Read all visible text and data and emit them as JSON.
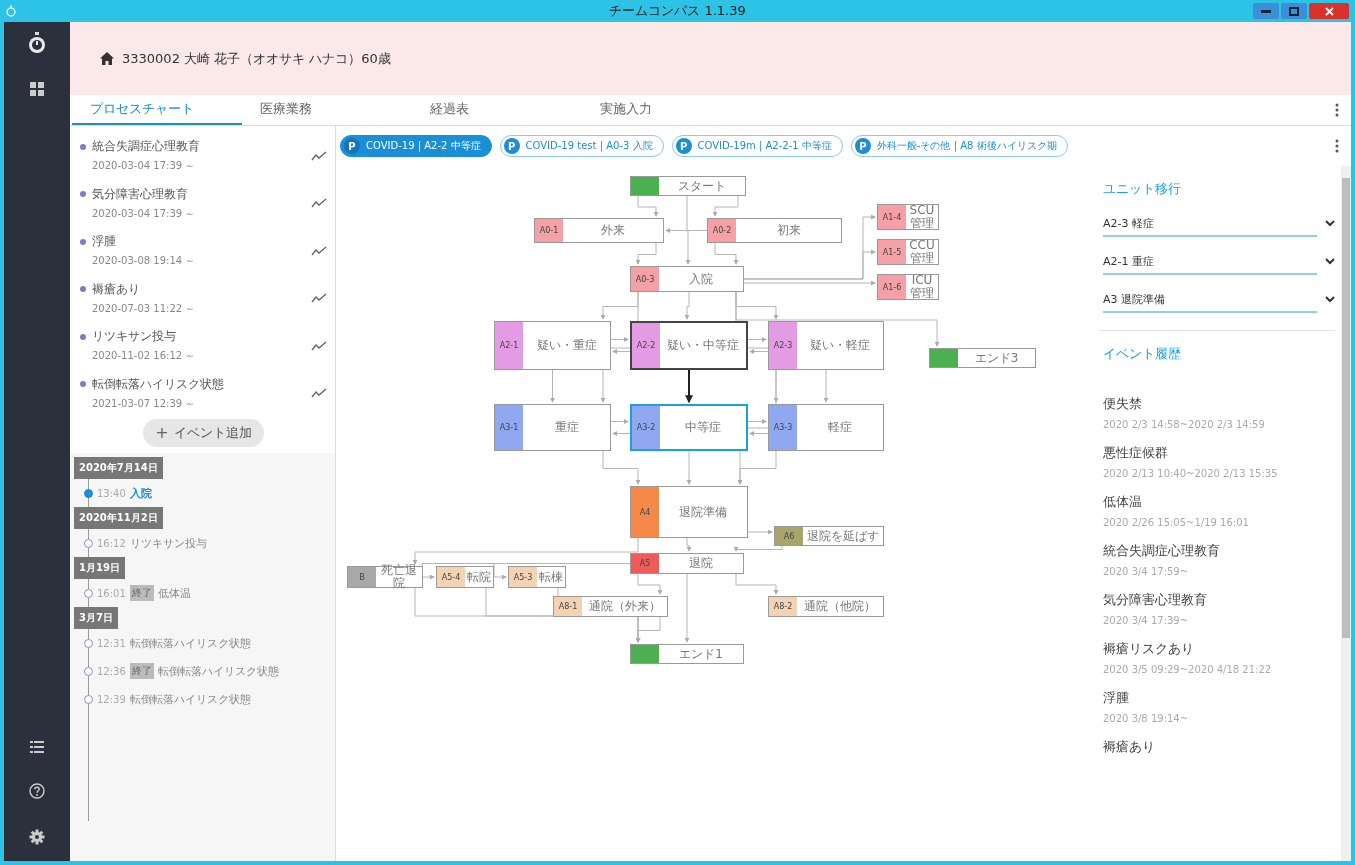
{
  "window": {
    "title": "チームコンパス 1.1.39"
  },
  "patient": {
    "label": "3330002 大崎 花子（オオサキ ハナコ）60歳"
  },
  "tabs": [
    {
      "label": "プロセスチャート",
      "selected": true
    },
    {
      "label": "医療業務",
      "selected": false
    },
    {
      "label": "経過表",
      "selected": false
    },
    {
      "label": "実施入力",
      "selected": false
    }
  ],
  "events": [
    {
      "title": "統合失調症心理教育",
      "date": "2020-03-04 17:39 ～"
    },
    {
      "title": "気分障害心理教育",
      "date": "2020-03-04 17:39 ～"
    },
    {
      "title": "浮腫",
      "date": "2020-03-08 19:14 ～"
    },
    {
      "title": "褥瘡あり",
      "date": "2020-07-03 11:22 ～"
    },
    {
      "title": "リツキサン投与",
      "date": "2020-11-02 16:12 ～"
    },
    {
      "title": "転倒転落ハイリスク状態",
      "date": "2021-03-07 12:39 ～"
    }
  ],
  "add_event_button": {
    "icon": "+",
    "label": "イベント追加"
  },
  "timeline": [
    {
      "date": "2020年7月14日",
      "entries": [
        {
          "time": "13:40",
          "text": "入院",
          "selected": true
        }
      ]
    },
    {
      "date": "2020年11月2日",
      "entries": [
        {
          "time": "16:12",
          "text": "リツキサン投与",
          "selected": false
        }
      ]
    },
    {
      "date": "1月19日",
      "entries": [
        {
          "time": "16:01",
          "tag": "終了",
          "text": "低体温",
          "selected": false
        }
      ]
    },
    {
      "date": "3月7日",
      "entries": [
        {
          "time": "12:31",
          "text": "転倒転落ハイリスク状態",
          "selected": false
        },
        {
          "time": "12:36",
          "tag": "終了",
          "text": "転倒転落ハイリスク状態",
          "selected": false
        },
        {
          "time": "12:39",
          "text": "転倒転落ハイリスク状態",
          "selected": false
        }
      ]
    }
  ],
  "pathways": [
    {
      "badge": "P",
      "label": "COVID-19 | A2-2 中等症",
      "selected": true
    },
    {
      "badge": "P",
      "label": "COVID-19 test | A0-3 入院",
      "selected": false
    },
    {
      "badge": "P",
      "label": "COVID-19m | A2-2-1 中等症",
      "selected": false
    },
    {
      "badge": "P",
      "label": "外科一般-その他 | A8 術後ハイリスク期",
      "selected": false
    }
  ],
  "chart_nodes": [
    {
      "name": "スタート",
      "color": "#4caf50",
      "selected": false,
      "visited": false
    },
    {
      "code": "A0-1",
      "name": "外来",
      "color": "#f4a0a6",
      "selected": false,
      "visited": false
    },
    {
      "code": "A0-2",
      "name": "初来",
      "color": "#f4a0a6",
      "selected": false,
      "visited": false
    },
    {
      "code": "A0-3",
      "name": "入院",
      "color": "#f4a0a6",
      "selected": false,
      "visited": false
    },
    {
      "code": "A1-4",
      "name": "SCU 管理",
      "color": "#f4a0a6",
      "selected": false,
      "visited": false
    },
    {
      "code": "A1-5",
      "name": "CCU 管理",
      "color": "#f4a0a6",
      "selected": false,
      "visited": false
    },
    {
      "code": "A1-6",
      "name": "ICU 管理",
      "color": "#f4a0a6",
      "selected": false,
      "visited": false
    },
    {
      "code": "A2-1",
      "name": "疑い・重症",
      "color": "#e39be3",
      "selected": false,
      "visited": false
    },
    {
      "code": "A2-2",
      "name": "疑い・中等症",
      "color": "#e39be3",
      "selected": false,
      "visited": true
    },
    {
      "code": "A2-3",
      "name": "疑い・軽症",
      "color": "#e39be3",
      "selected": false,
      "visited": false
    },
    {
      "name": "エンド3",
      "color": "#4caf50",
      "selected": false,
      "visited": false
    },
    {
      "code": "A3-1",
      "name": "重症",
      "color": "#8fa8f0",
      "selected": false,
      "visited": false
    },
    {
      "code": "A3-2",
      "name": "中等症",
      "color": "#8fa8f0",
      "selected": true,
      "visited": false
    },
    {
      "code": "A3-3",
      "name": "軽症",
      "color": "#8fa8f0",
      "selected": false,
      "visited": false
    },
    {
      "code": "A4",
      "name": "退院準備",
      "color": "#f5894a",
      "selected": false,
      "visited": false
    },
    {
      "code": "A6",
      "name": "退院を延ばす",
      "color": "#a9a56a",
      "selected": false,
      "visited": false
    },
    {
      "code": "A5",
      "name": "退院",
      "color": "#ef5a5a",
      "selected": false,
      "visited": false
    },
    {
      "code": "B",
      "name": "死亡退院",
      "color": "#a8a8a8",
      "selected": false,
      "visited": false
    },
    {
      "code": "A5-4",
      "name": "転院",
      "color": "#f4d2b4",
      "selected": false,
      "visited": false
    },
    {
      "code": "A5-3",
      "name": "転棟",
      "color": "#f4d2b4",
      "selected": false,
      "visited": false
    },
    {
      "code": "A8-1",
      "name": "通院（外来）",
      "color": "#f4d2b4",
      "selected": false,
      "visited": false
    },
    {
      "code": "A8-2",
      "name": "通院（他院）",
      "color": "#f4d2b4",
      "selected": false,
      "visited": false
    },
    {
      "name": "エンド1",
      "color": "#4caf50",
      "selected": false,
      "visited": false
    }
  ],
  "unit_transition": {
    "title": "ユニット移行",
    "options": [
      "A2-3 軽症",
      "A2-1 重症",
      "A3 退院準備"
    ]
  },
  "event_history": {
    "title": "イベント履歴",
    "items": [
      {
        "title": "便失禁",
        "period": "2020 2/3 14:58~2020 2/3 14:59"
      },
      {
        "title": "悪性症候群",
        "period": "2020 2/13 10:40~2020 2/13 15:35"
      },
      {
        "title": "低体温",
        "period": "2020 2/26 15:05~1/19 16:01"
      },
      {
        "title": "統合失調症心理教育",
        "period": "2020 3/4 17:59~"
      },
      {
        "title": "気分障害心理教育",
        "period": "2020 3/4 17:39~"
      },
      {
        "title": "褥瘡リスクあり",
        "period": "2020 3/5 09:29~2020 4/18 21:22"
      },
      {
        "title": "浮腫",
        "period": "2020 3/8 19:14~"
      },
      {
        "title": "褥瘡あり"
      }
    ]
  }
}
